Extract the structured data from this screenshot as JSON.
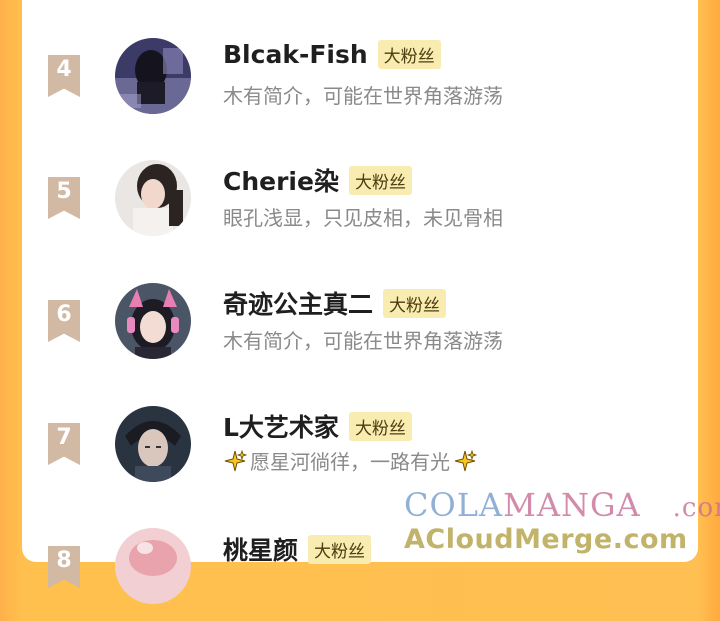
{
  "fans": [
    {
      "rank": "4",
      "name": "Blcak-Fish",
      "badge": "大粉丝",
      "bio": "木有简介，可能在世界角落游荡",
      "avatar": "dark-scene-avatar"
    },
    {
      "rank": "5",
      "name": "Cherie染",
      "badge": "大粉丝",
      "bio": "眼孔浅显，只见皮相，未见骨相",
      "avatar": "girl-selfie-avatar"
    },
    {
      "rank": "6",
      "name": "奇迹公主真二",
      "badge": "大粉丝",
      "bio": "木有简介，可能在世界角落游荡",
      "avatar": "anime-headphones-avatar"
    },
    {
      "rank": "7",
      "name": "L大艺术家",
      "badge": "大粉丝",
      "bio": "愿星河徜徉，一路有光",
      "avatar": "anime-boy-avatar"
    },
    {
      "rank": "8",
      "name": "桃星颜",
      "badge": "大粉丝",
      "bio": "",
      "avatar": "pink-avatar"
    }
  ],
  "watermark": {
    "line1_cola": "COLA",
    "line1_manga": "MANGA",
    "line1_com": ".com",
    "line2": "ACloudMerge.com"
  },
  "colors": {
    "background_orange": "#ffbf52",
    "rank_ribbon": "#d1b9a4",
    "badge_bg": "#f9ecb0",
    "bio_text": "#8a8a8a"
  }
}
